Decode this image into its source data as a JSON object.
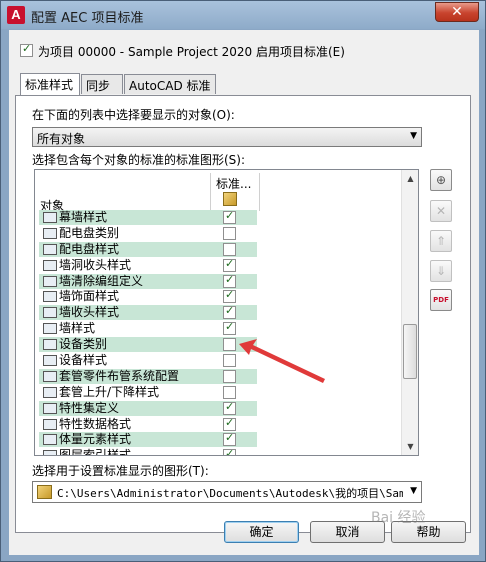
{
  "window": {
    "app_icon": "A",
    "title": "配置 AEC 项目标准",
    "close_glyph": "✕"
  },
  "enable_checkbox": {
    "checked": true,
    "label": "为项目 00000 - Sample Project 2020 启用项目标准(E)"
  },
  "tabs": [
    {
      "label": "标准样式",
      "active": true
    },
    {
      "label": "同步",
      "active": false
    },
    {
      "label": "AutoCAD 标准",
      "active": false
    }
  ],
  "object_select": {
    "label": "在下面的列表中选择要显示的对象(O):",
    "value": "所有对象"
  },
  "list": {
    "label": "选择包含每个对象的标准的标准图形(S):",
    "col_object": "对象",
    "col_standard": "标准...",
    "rows": [
      {
        "name": "幕墙样式",
        "icon": "curtain-wall-icon",
        "checked": true,
        "selected": true
      },
      {
        "name": "配电盘类别",
        "icon": "panel-category-icon",
        "checked": false,
        "selected": false
      },
      {
        "name": "配电盘样式",
        "icon": "panel-style-icon",
        "checked": false,
        "selected": true
      },
      {
        "name": "墙洞收头样式",
        "icon": "wall-opening-icon",
        "checked": true,
        "selected": false
      },
      {
        "name": "墙清除编组定义",
        "icon": "wall-cleanup-icon",
        "checked": true,
        "selected": true
      },
      {
        "name": "墙饰面样式",
        "icon": "wall-finish-icon",
        "checked": true,
        "selected": false
      },
      {
        "name": "墙收头样式",
        "icon": "wall-endcap-icon",
        "checked": true,
        "selected": true
      },
      {
        "name": "墙样式",
        "icon": "wall-style-icon",
        "checked": true,
        "selected": false
      },
      {
        "name": "设备类别",
        "icon": "device-category-icon",
        "checked": false,
        "selected": true
      },
      {
        "name": "设备样式",
        "icon": "device-style-icon",
        "checked": false,
        "selected": false
      },
      {
        "name": "套管零件布管系统配置",
        "icon": "sleeve-config-icon",
        "checked": false,
        "selected": true
      },
      {
        "name": "套管上升/下降样式",
        "icon": "sleeve-rise-drop-icon",
        "checked": false,
        "selected": false
      },
      {
        "name": "特性集定义",
        "icon": "property-set-icon",
        "checked": true,
        "selected": true
      },
      {
        "name": "特性数据格式",
        "icon": "property-format-icon",
        "checked": true,
        "selected": false
      },
      {
        "name": "体量元素样式",
        "icon": "mass-element-icon",
        "checked": true,
        "selected": true
      },
      {
        "name": "图层索引样式",
        "icon": "layer-index-icon",
        "checked": true,
        "selected": false
      }
    ]
  },
  "side_buttons": [
    {
      "name": "add-drawing-button",
      "glyph": "⊕",
      "enabled": true
    },
    {
      "name": "remove-drawing-button",
      "glyph": "✕",
      "enabled": false
    },
    {
      "name": "move-up-button",
      "glyph": "⇑",
      "enabled": false
    },
    {
      "name": "move-down-button",
      "glyph": "⇓",
      "enabled": false
    },
    {
      "name": "pdf-button",
      "glyph": "PDF",
      "enabled": true
    }
  ],
  "display_drawing": {
    "label": "选择用于设置标准显示的图形(T):",
    "value": "C:\\Users\\Administrator\\Documents\\Autodesk\\我的项目\\Sample"
  },
  "buttons": {
    "ok": "确定",
    "cancel": "取消",
    "help": "帮助"
  },
  "watermark": "Bai 经验",
  "colors": {
    "row_highlight": "#c8e6d6",
    "arrow": "#e03a3a",
    "close": "#c8442e"
  }
}
